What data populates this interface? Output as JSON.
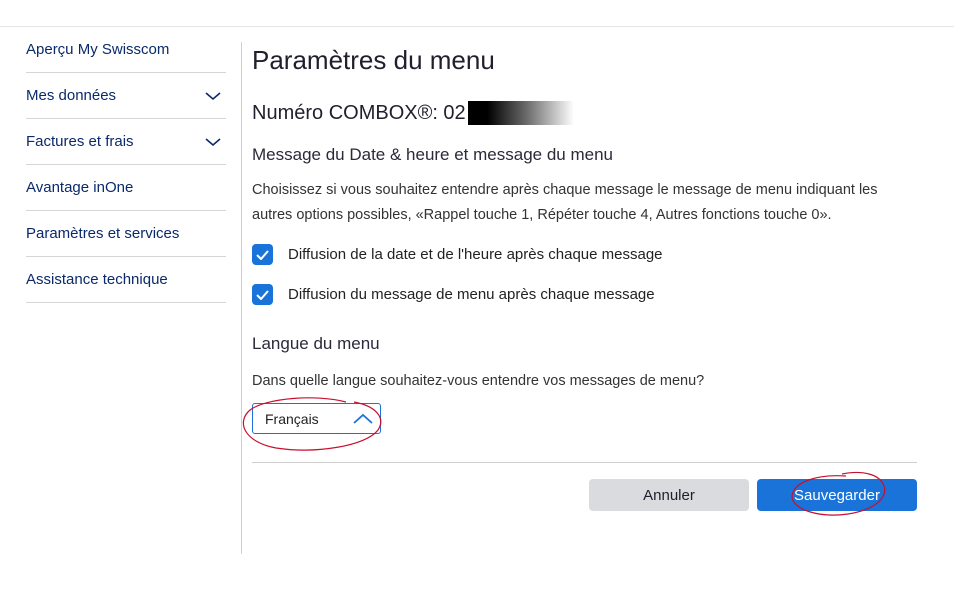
{
  "sidebar": {
    "items": [
      {
        "label": "Aperçu My Swisscom",
        "expandable": false
      },
      {
        "label": "Mes données",
        "expandable": true
      },
      {
        "label": "Factures et frais",
        "expandable": true
      },
      {
        "label": "Avantage inOne",
        "expandable": false
      },
      {
        "label": "Paramètres et services",
        "expandable": false
      },
      {
        "label": "Assistance technique",
        "expandable": false
      }
    ]
  },
  "main": {
    "title": "Paramètres du menu",
    "combox_label": "Numéro COMBOX®: 02",
    "message_section": {
      "title": "Message du Date & heure et message du menu",
      "description": "Choisissez si vous souhaitez entendre après chaque message le message de menu indiquant les autres options possibles, «Rappel touche 1, Répéter touche 4, Autres fonctions touche 0».",
      "options": [
        {
          "label": "Diffusion de la date et de l'heure après chaque message",
          "checked": true
        },
        {
          "label": "Diffusion du message de menu après chaque message",
          "checked": true
        }
      ]
    },
    "language_section": {
      "title": "Langue du menu",
      "question": "Dans quelle langue souhaitez-vous entendre vos messages de menu?",
      "selected": "Français"
    },
    "actions": {
      "cancel_label": "Annuler",
      "save_label": "Sauvegarder"
    }
  },
  "colors": {
    "accent": "#1a73d9",
    "nav_text": "#0a2a6b",
    "cancel_bg": "#d9dbdf",
    "annotation": "#c8102e"
  }
}
